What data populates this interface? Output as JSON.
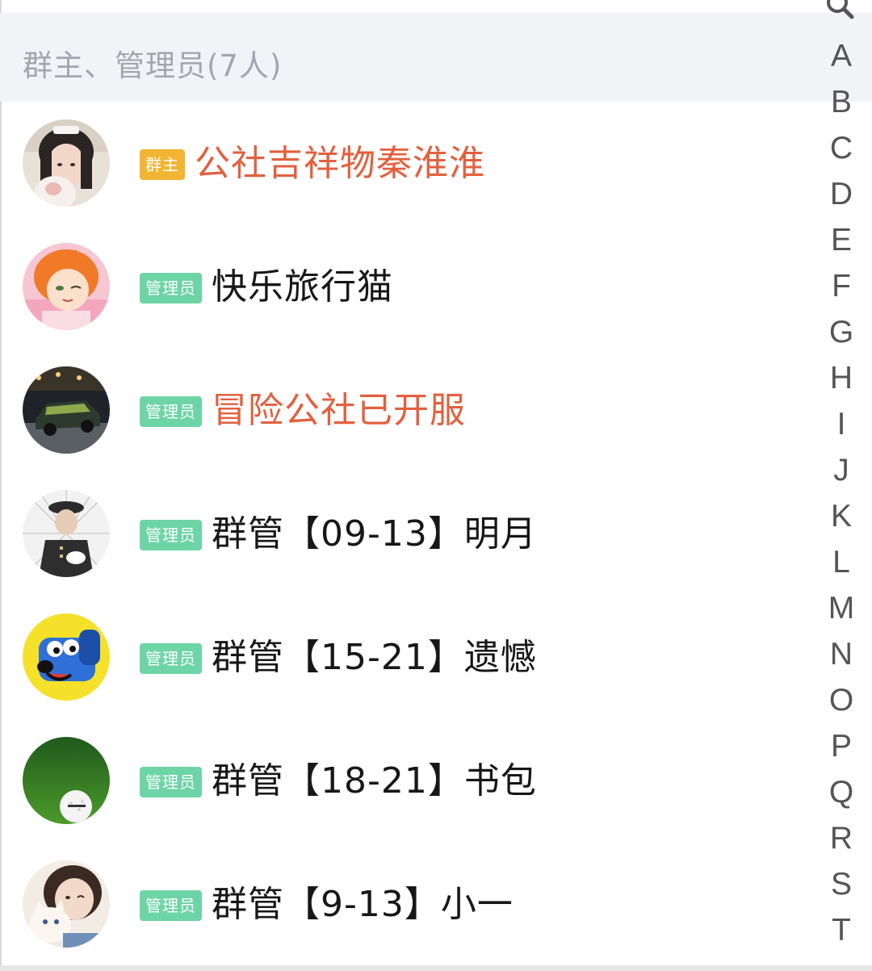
{
  "section": {
    "title": "群主、管理员(7人)"
  },
  "badges": {
    "owner": "群主",
    "admin": "管理员"
  },
  "members": [
    {
      "role": "owner",
      "badge": "群主",
      "name": "公社吉祥物秦淮淮",
      "highlight": true,
      "avatar": "girl-photo-avatar"
    },
    {
      "role": "admin",
      "badge": "管理员",
      "name": "快乐旅行猫",
      "highlight": false,
      "avatar": "anime-orange-hair-avatar"
    },
    {
      "role": "admin",
      "badge": "管理员",
      "name": "冒险公社已开服",
      "highlight": true,
      "avatar": "race-car-avatar"
    },
    {
      "role": "admin",
      "badge": "管理员",
      "name": "群管【09-13】明月",
      "highlight": false,
      "avatar": "uniform-officer-avatar"
    },
    {
      "role": "admin",
      "badge": "管理员",
      "name": "群管【15-21】遗憾",
      "highlight": false,
      "avatar": "pixel-blue-dog-avatar"
    },
    {
      "role": "admin",
      "badge": "管理员",
      "name": "群管【18-21】书包",
      "highlight": false,
      "avatar": "golf-ball-grass-avatar"
    },
    {
      "role": "admin",
      "badge": "管理员",
      "name": "群管【9-13】小一",
      "highlight": false,
      "avatar": "girl-with-cat-avatar"
    }
  ],
  "alpha_index": {
    "search_icon": "search-icon",
    "letters": [
      "A",
      "B",
      "C",
      "D",
      "E",
      "F",
      "G",
      "H",
      "I",
      "J",
      "K",
      "L",
      "M",
      "N",
      "O",
      "P",
      "Q",
      "R",
      "S",
      "T"
    ]
  },
  "colors": {
    "owner_badge": "#f2b533",
    "admin_badge": "#6dd4a6",
    "highlight_name": "#e2603f",
    "normal_name": "#171717",
    "section_bg": "#f2f3f7",
    "section_text": "#a3a6ad"
  }
}
